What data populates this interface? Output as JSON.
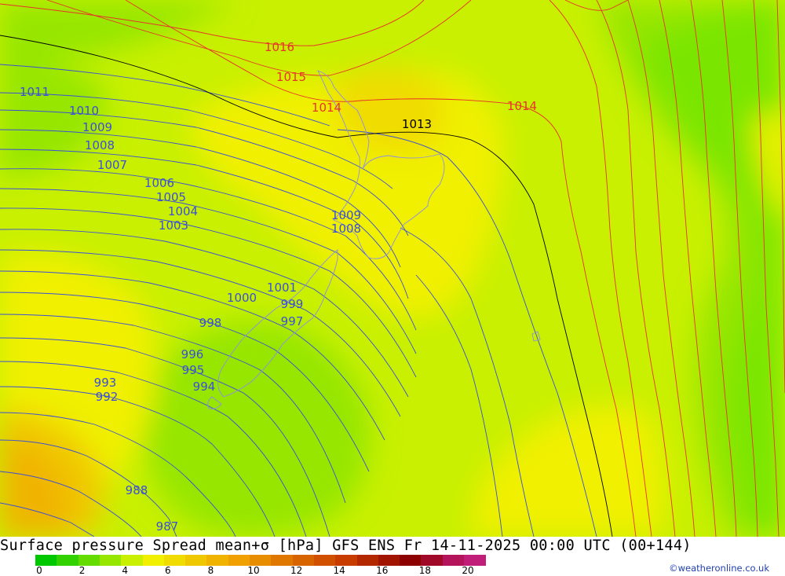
{
  "title": "Surface pressure Spread mean+σ [hPa] GFS ENS  Fr 14-11-2025 00:00 UTC (00+144)",
  "credit": "©weatheronline.co.uk",
  "colors": {
    "isobar_low": "#3b4fd8",
    "isobar_mid": "#000000",
    "isobar_high": "#e8332a",
    "coastline": "#8e8ee6"
  },
  "legend": {
    "ticks": [
      "0",
      "2",
      "4",
      "6",
      "8",
      "10",
      "12",
      "14",
      "16",
      "18",
      "20"
    ],
    "colors": [
      "#00c800",
      "#32d200",
      "#64dc00",
      "#96e600",
      "#c8f000",
      "#f0f000",
      "#f0dc00",
      "#f0c800",
      "#f0b400",
      "#f0a000",
      "#e88c00",
      "#e07800",
      "#d86400",
      "#d05000",
      "#c83c00",
      "#b42800",
      "#a01400",
      "#8c0000",
      "#a00a28",
      "#b4145a",
      "#c01e78"
    ]
  },
  "map": {
    "type": "contour-map",
    "field": "Surface pressure spread",
    "isobar_labels": [
      {
        "name": "label-1016",
        "text": "1016",
        "tier": "high"
      },
      {
        "name": "label-1015",
        "text": "1015",
        "tier": "high"
      },
      {
        "name": "label-1014-west",
        "text": "1014",
        "tier": "high"
      },
      {
        "name": "label-1014-east",
        "text": "1014",
        "tier": "high"
      },
      {
        "name": "label-1013",
        "text": "1013",
        "tier": "mid"
      },
      {
        "name": "label-1011",
        "text": "1011",
        "tier": "low"
      },
      {
        "name": "label-1010",
        "text": "1010",
        "tier": "low"
      },
      {
        "name": "label-1009-west",
        "text": "1009",
        "tier": "low"
      },
      {
        "name": "label-1008-west",
        "text": "1008",
        "tier": "low"
      },
      {
        "name": "label-1007",
        "text": "1007",
        "tier": "low"
      },
      {
        "name": "label-1006",
        "text": "1006",
        "tier": "low"
      },
      {
        "name": "label-1005",
        "text": "1005",
        "tier": "low"
      },
      {
        "name": "label-1004",
        "text": "1004",
        "tier": "low"
      },
      {
        "name": "label-1003",
        "text": "1003",
        "tier": "low"
      },
      {
        "name": "label-1009-east",
        "text": "1009",
        "tier": "low"
      },
      {
        "name": "label-1008-east",
        "text": "1008",
        "tier": "low"
      },
      {
        "name": "label-1001",
        "text": "1001",
        "tier": "low"
      },
      {
        "name": "label-1000",
        "text": "1000",
        "tier": "low"
      },
      {
        "name": "label-999",
        "text": "999",
        "tier": "low"
      },
      {
        "name": "label-998",
        "text": "998",
        "tier": "low"
      },
      {
        "name": "label-997",
        "text": "997",
        "tier": "low"
      },
      {
        "name": "label-996",
        "text": "996",
        "tier": "low"
      },
      {
        "name": "label-995",
        "text": "995",
        "tier": "low"
      },
      {
        "name": "label-994",
        "text": "994",
        "tier": "low"
      },
      {
        "name": "label-993",
        "text": "993",
        "tier": "low"
      },
      {
        "name": "label-992",
        "text": "992",
        "tier": "low"
      },
      {
        "name": "label-988",
        "text": "988",
        "tier": "low"
      },
      {
        "name": "label-987",
        "text": "987",
        "tier": "low"
      }
    ]
  }
}
